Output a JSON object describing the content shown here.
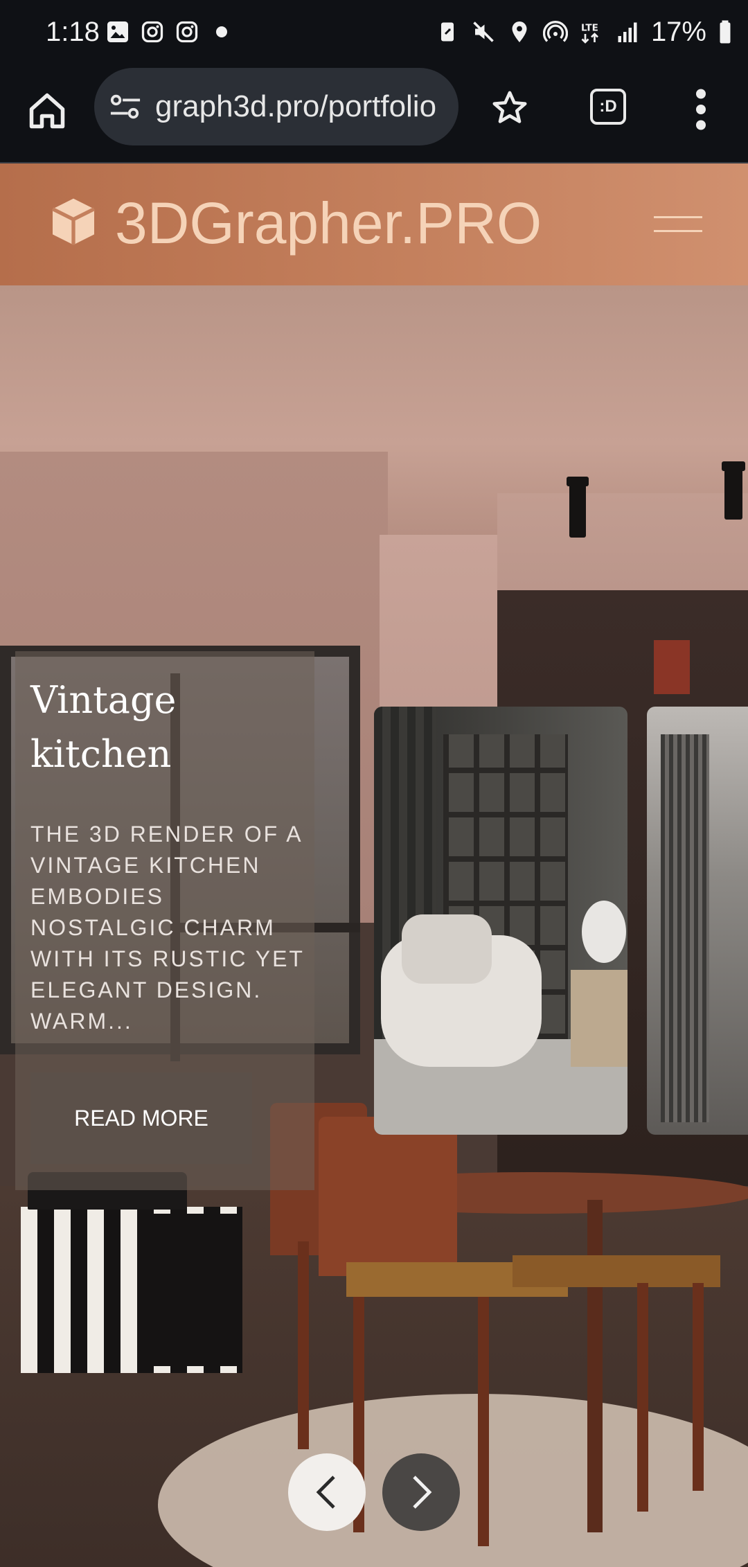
{
  "status_bar": {
    "time": "1:18",
    "left_icons": [
      "gallery-icon",
      "instagram-icon",
      "instagram-icon",
      "dot-icon"
    ],
    "right_icons": [
      "data-saver-icon",
      "mute-icon",
      "location-icon",
      "hotspot-icon",
      "lte-icon",
      "signal-icon",
      "battery-icon"
    ],
    "battery_percent": "17%"
  },
  "browser": {
    "url": "graph3d.pro/portfolio",
    "tab_switcher_label": ":D"
  },
  "site": {
    "logo_text": "3DGrapher.PRO",
    "brand_color": "#c4805d",
    "logo_color": "#f5d3b8"
  },
  "slide": {
    "title": "Vintage kitchen",
    "description": "THE 3D RENDER OF A VINTAGE KITCHEN EMBODIES NOSTALGIC CHARM WITH ITS RUSTIC YET ELEGANT DESIGN. WARM...",
    "read_more_label": "READ MORE"
  },
  "carousel": {
    "prev_icon": "chevron-left-icon",
    "next_icon": "chevron-right-icon"
  }
}
